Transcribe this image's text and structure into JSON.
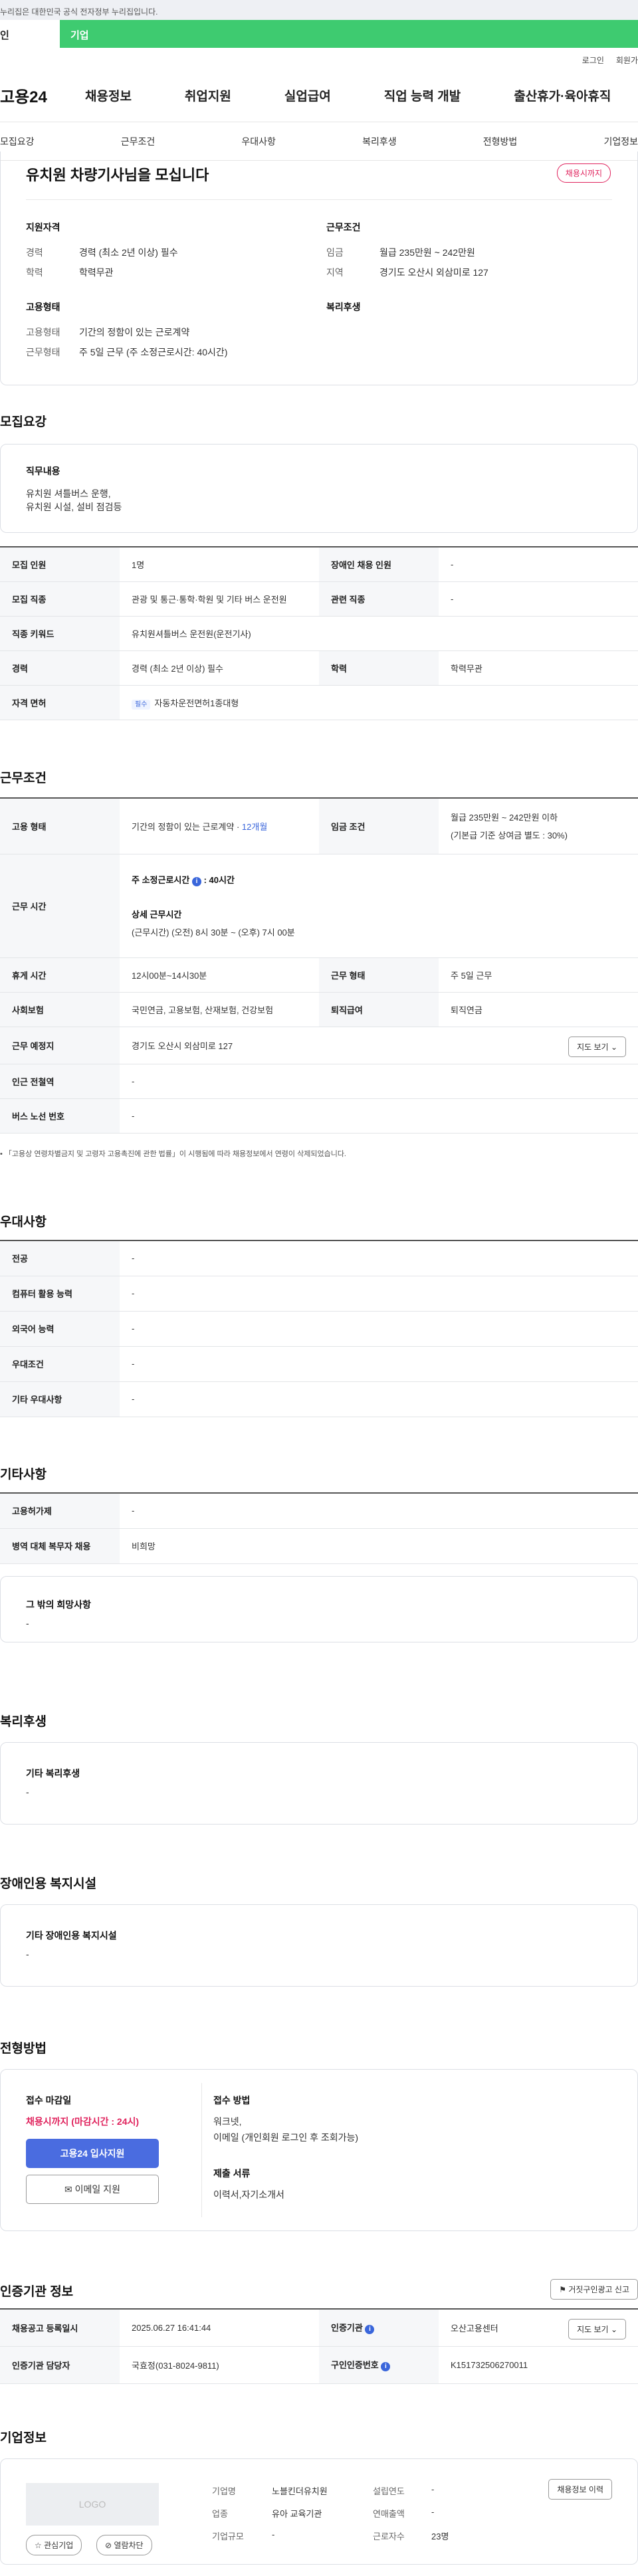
{
  "gov_notice": "누리집은 대한민국 공식 전자정부 누리집입니다.",
  "top_tabs": [
    "인",
    "기업"
  ],
  "util": [
    "로그인",
    "회원가"
  ],
  "logo": "고용24",
  "gnb": [
    "채용정보",
    "취업지원",
    "실업급여",
    "직업 능력 개발",
    "출산휴가·육아휴직"
  ],
  "subnav": [
    "모집요강",
    "근무조건",
    "우대사항",
    "복리후생",
    "전형방법",
    "기업정보"
  ],
  "summary": {
    "title": "유치원 차량기사님을 모십니다",
    "status_badge": "채용시까지",
    "support_heading": "지원자격",
    "career_label": "경력",
    "career_value": "경력 (최소 2년 이상) 필수",
    "edu_label": "학력",
    "edu_value": "학력무관",
    "work_heading": "근무조건",
    "wage_label": "임금",
    "wage_value": "월급 235만원 ~ 242만원",
    "area_label": "지역",
    "area_value": "경기도 오산시 외삼미로 127",
    "emp_heading": "고용형태",
    "emptype_label": "고용형태",
    "emptype_value": "기간의 정함이 있는 근로계약",
    "workform_label": "근무형태",
    "workform_value": "주 5일 근무 (주 소정근로시간: 40시간)",
    "welfare_heading": "복리후생"
  },
  "recruit": {
    "title": "모집요강",
    "duty_heading": "직무내용",
    "duty_lines": [
      "유치원 셔틀버스 운행,",
      "유치원 시설, 설비 점검등"
    ],
    "rows": {
      "count_h": "모집 인원",
      "count_v": "1명",
      "disabled_h": "장애인 채용 인원",
      "disabled_v": "-",
      "job_h": "모집 직종",
      "job_v": "관광 및 통근·통학·학원 및 기타 버스 운전원",
      "related_h": "관련 직종",
      "related_v": "-",
      "keyword_h": "직종 키워드",
      "keyword_v": "유치원셔틀버스 운전원(운전기사)",
      "career_h": "경력",
      "career_v": "경력 (최소 2년 이상) 필수",
      "edu_h": "학력",
      "edu_v": "학력무관",
      "license_h": "자격 면허",
      "license_chip": "필수",
      "license_v": "자동차운전면허1종대형"
    }
  },
  "conditions": {
    "title": "근무조건",
    "emp_h": "고용 형태",
    "emp_v": "기간의 정함이 있는 근로계약 · ",
    "emp_period": "12개월",
    "wage_h": "임금 조건",
    "wage_v1": "월급 235만원 ~ 242만원 이하",
    "wage_v2": "(기본급 기준 상여금 별도 : 30%)",
    "time_h": "근무 시간",
    "time_main_label": "주 소정근로시간",
    "time_main_value": ": 40시간",
    "time_detail_label": "상세 근무시간",
    "time_detail_value": "(근무시간) (오전) 8시 30분 ~ (오후) 7시 00분",
    "break_h": "휴게 시간",
    "break_v": "12시00분~14시30분",
    "form_h": "근무 형태",
    "form_v": "주 5일 근무",
    "ins_h": "사회보험",
    "ins_v": "국민연금, 고용보험, 산재보험, 건강보험",
    "retire_h": "퇴직급여",
    "retire_v": "퇴직연금",
    "place_h": "근무 예정지",
    "place_v": "경기도 오산시 외삼미로 127",
    "map_btn": "지도 보기",
    "subway_h": "인근 전철역",
    "subway_v": "-",
    "bus_h": "버스 노선 번호",
    "bus_v": "-",
    "note": "「고용상 연령차별금지 및 고령자 고용촉진에 관한 법률」이 시행됨에 따라 채용정보에서 연령이 삭제되었습니다."
  },
  "prefer": {
    "title": "우대사항",
    "rows": [
      {
        "h": "전공",
        "v": "-"
      },
      {
        "h": "컴퓨터 활용 능력",
        "v": "-"
      },
      {
        "h": "외국어 능력",
        "v": "-"
      },
      {
        "h": "우대조건",
        "v": "-"
      },
      {
        "h": "기타 우대사항",
        "v": "-"
      }
    ]
  },
  "etc": {
    "title": "기타사항",
    "rows": [
      {
        "h": "고용허가제",
        "v": "-"
      },
      {
        "h": "병역 대체 복무자 채용",
        "v": "비희망"
      }
    ],
    "hope_heading": "그 밖의 희망사항",
    "hope_value": "-"
  },
  "welfare": {
    "title": "복리후생",
    "heading": "기타 복리후생",
    "value": "-"
  },
  "disabled": {
    "title": "장애인용 복지시설",
    "heading": "기타 장애인용 복지시설",
    "value": "-"
  },
  "selection": {
    "title": "전형방법",
    "deadline_heading": "접수 마감일",
    "deadline_value": "채용시까지 (마감시간 : 24시)",
    "apply_btn": "고용24 입사지원",
    "email_btn": "이메일 지원",
    "method_heading": "접수 방법",
    "method_lines": [
      "워크넷,",
      "이메일 (개인회원 로그인 후 조회가능)"
    ],
    "docs_heading": "제출 서류",
    "docs_value": "이력서,자기소개서"
  },
  "cert": {
    "title": "인증기관 정보",
    "report_btn": "거짓구인광고 신고",
    "reg_h": "채용공고 등록일시",
    "reg_v": "2025.06.27 16:41:44",
    "org_h": "인증기관",
    "org_v": "오산고용센터",
    "map_btn": "지도 보기",
    "manager_h": "인증기관 담당자",
    "manager_v": "국효정(031-8024-9811)",
    "num_h": "구인인증번호",
    "num_v": "K151732506270011"
  },
  "company": {
    "title": "기업정보",
    "logo_text": "LOGO",
    "fav_btn": "관심기업",
    "block_btn": "열람차단",
    "history_btn": "채용정보 이력",
    "name_h": "기업명",
    "name_v": "노블킨더유치원",
    "year_h": "설립연도",
    "year_v": "-",
    "biz_h": "업종",
    "biz_v": "유아 교육기관",
    "sales_h": "연매출액",
    "sales_v": "-",
    "scale_h": "기업규모",
    "scale_v": "-",
    "staff_h": "근로자수",
    "staff_v": "23명"
  }
}
